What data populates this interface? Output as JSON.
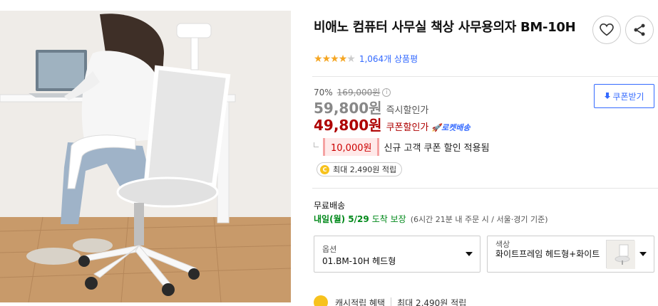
{
  "product": {
    "title": "비애노 컴퓨터 사무실 책상 사무용의자 BM-10H",
    "rating_stars": 4,
    "review_count": "1,064개 상품평"
  },
  "actions": {
    "wishlist_icon": "heart-icon",
    "share_icon": "share-icon"
  },
  "price": {
    "discount_rate": "70%",
    "original_price": "169,000원",
    "info_icon": "i",
    "coupon_download_label": "쿠폰받기",
    "instant_price": "59,800원",
    "instant_label": "즉시할인가",
    "coupon_price": "49,800원",
    "coupon_label": "쿠폰할인가",
    "rocket_label": "로켓배송",
    "new_customer_amount": "10,000원",
    "new_customer_text": "신규 고객 쿠폰 할인 적용됨",
    "cashback_text": "최대 2,490원 적립"
  },
  "shipping": {
    "title": "무료배송",
    "date": "내일(월) 5/29",
    "guarantee": "도착 보장",
    "note": "(6시간 21분  내 주문 시 / 서울·경기 기준)"
  },
  "options": [
    {
      "label": "옵션",
      "value": "01.BM-10H 헤드형"
    },
    {
      "label": "색상",
      "value": "화이트프레임 헤드형+화이트"
    }
  ],
  "cashback_footer": {
    "label": "캐시적립 혜택",
    "value": "최대 2,490원 적립"
  },
  "colors": {
    "brand_blue": "#346aff",
    "price_red": "#ae0000",
    "delivery_green": "#00891a",
    "star_gold": "#f5a623"
  }
}
